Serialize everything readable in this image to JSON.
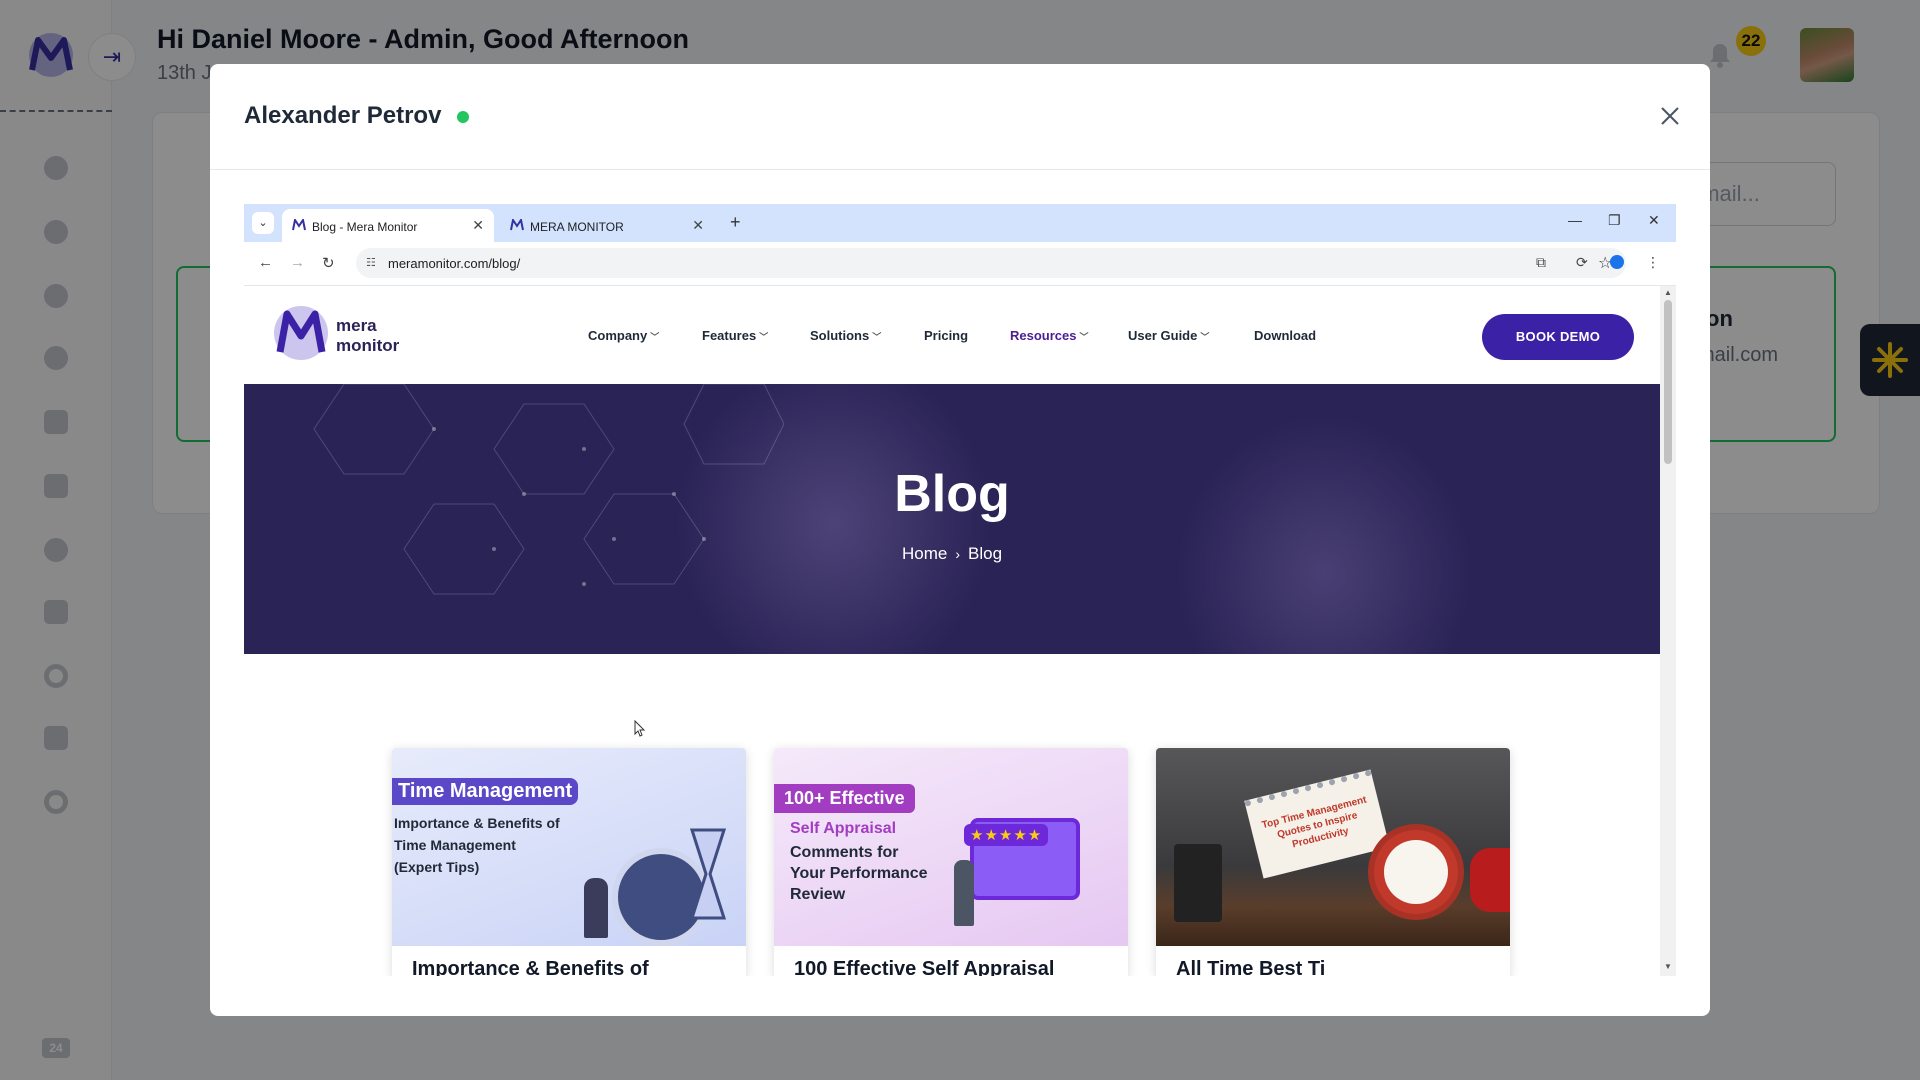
{
  "app": {
    "greeting": "Hi Daniel Moore - Admin, Good Afternoon",
    "date_partial": "13th J",
    "notification_count": "22",
    "bottom_badge": "24",
    "search_placeholder": "email...",
    "bg_card_title_partial": "on",
    "bg_card_email_partial": "mail.com",
    "colors": {
      "brand": "#3730a3",
      "status_online": "#22c55e",
      "badge": "#facc15"
    }
  },
  "modal": {
    "title": "Alexander Petrov",
    "status": "online",
    "close_icon": "close-icon"
  },
  "browser": {
    "tabs": [
      {
        "label": "Blog - Mera Monitor",
        "active": true
      },
      {
        "label": "MERA MONITOR",
        "active": false
      }
    ],
    "url": "meramonitor.com/blog/"
  },
  "site": {
    "logo_line1": "mera",
    "logo_line2": "monitor",
    "menu": [
      {
        "label": "Company",
        "dropdown": true
      },
      {
        "label": "Features",
        "dropdown": true
      },
      {
        "label": "Solutions",
        "dropdown": true
      },
      {
        "label": "Pricing",
        "dropdown": false
      },
      {
        "label": "Resources",
        "dropdown": true,
        "active": true
      },
      {
        "label": "User Guide",
        "dropdown": true
      },
      {
        "label": "Download",
        "dropdown": false
      }
    ],
    "cta": "BOOK DEMO",
    "hero": {
      "title": "Blog",
      "crumb_home": "Home",
      "crumb_separator": "›",
      "crumb_current": "Blog"
    },
    "cards": [
      {
        "image_tag": "Time Management",
        "image_text": [
          "Importance & Benefits of",
          "Time Management",
          "(Expert Tips)"
        ],
        "title_partial": "Importance & Benefits of"
      },
      {
        "image_tag": "100+ Effective",
        "image_subtitle": "Self Appraisal",
        "image_text": [
          "Comments for",
          "Your Performance",
          "Review"
        ],
        "image_stars": "★★★★★",
        "title_partial": "100 Effective Self Appraisal"
      },
      {
        "image_note": "Top Time Management Quotes to Inspire Productivity",
        "title_partial": "All Time Best Ti"
      }
    ]
  }
}
